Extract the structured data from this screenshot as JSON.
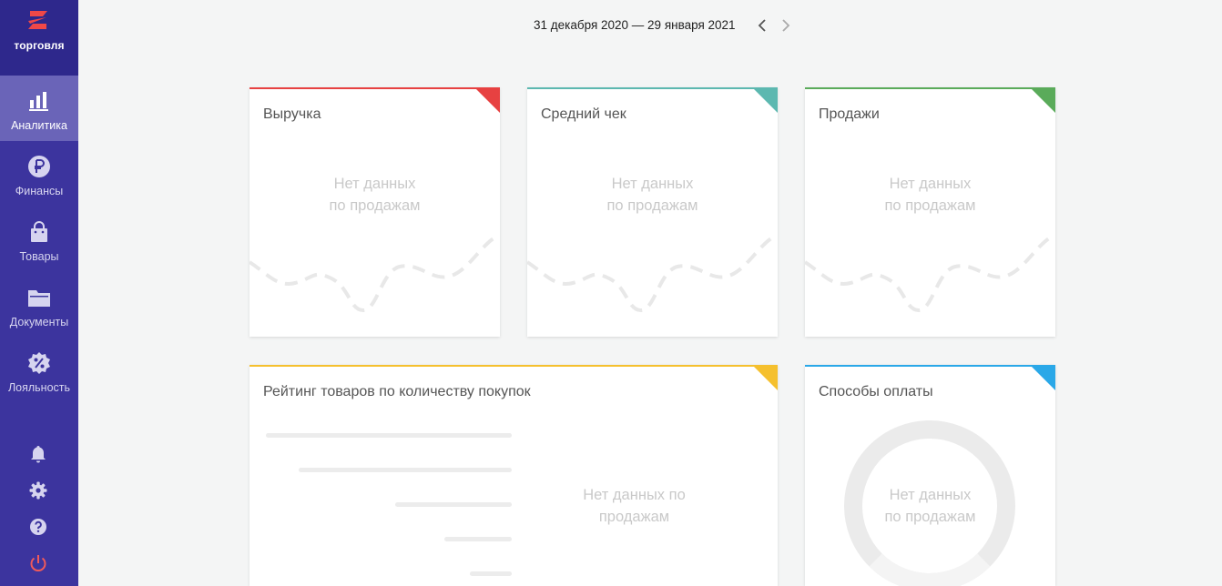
{
  "app": {
    "logo_text": "торговля"
  },
  "colors": {
    "sidebar": "#3c349e",
    "accent_red": "#e74141",
    "accent_teal": "#5cb8b0",
    "accent_green": "#5aab5a",
    "accent_yellow": "#f5c02e",
    "accent_blue": "#2aa8e8",
    "power_red": "#f05a5a"
  },
  "sidebar": {
    "items": [
      {
        "label": "Аналитика",
        "icon": "bar-chart-icon"
      },
      {
        "label": "Финансы",
        "icon": "ruble-coin-icon"
      },
      {
        "label": "Товары",
        "icon": "shopping-bag-icon"
      },
      {
        "label": "Документы",
        "icon": "folder-icon"
      },
      {
        "label": "Лояльность",
        "icon": "percent-badge-icon"
      }
    ],
    "bottom_icons": [
      "bell-icon",
      "gear-icon",
      "help-icon",
      "power-icon"
    ]
  },
  "period": {
    "text": "31 декабря 2020 — 29 января 2021"
  },
  "cards": {
    "revenue": {
      "title": "Выручка",
      "empty_line1": "Нет данных",
      "empty_line2": "по продажам"
    },
    "avg_check": {
      "title": "Средний чек",
      "empty_line1": "Нет данных",
      "empty_line2": "по продажам"
    },
    "sales": {
      "title": "Продажи",
      "empty_line1": "Нет данных",
      "empty_line2": "по продажам"
    },
    "rating": {
      "title": "Рейтинг товаров по количеству покупок",
      "empty_line1": "Нет данных по",
      "empty_line2": "продажам"
    },
    "payment": {
      "title": "Способы оплаты",
      "empty_line1": "Нет данных",
      "empty_line2": "по продажам"
    }
  }
}
